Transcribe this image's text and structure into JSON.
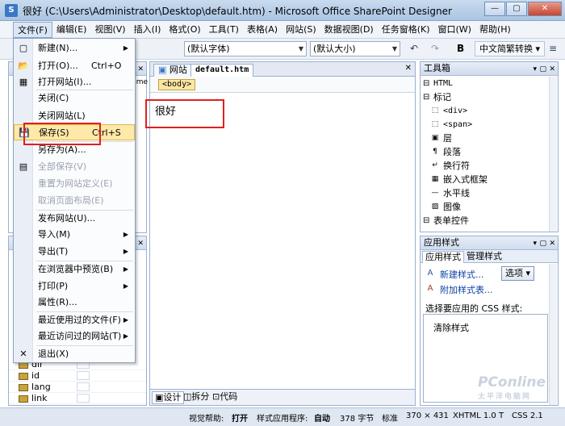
{
  "window": {
    "title": "很好 (C:\\Users\\Administrator\\Desktop\\default.htm) - Microsoft Office SharePoint Designer",
    "min": "—",
    "max": "▢",
    "close": "✕"
  },
  "menubar": [
    {
      "label": "文件(F)"
    },
    {
      "label": "编辑(E)"
    },
    {
      "label": "视图(V)"
    },
    {
      "label": "插入(I)"
    },
    {
      "label": "格式(O)"
    },
    {
      "label": "工具(T)"
    },
    {
      "label": "表格(A)"
    },
    {
      "label": "网站(S)"
    },
    {
      "label": "数据视图(D)"
    },
    {
      "label": "任务窗格(K)"
    },
    {
      "label": "窗口(W)"
    },
    {
      "label": "帮助(H)"
    }
  ],
  "toolbar": {
    "font": "(默认字体)",
    "size": "(默认大小)",
    "bold": "B",
    "convert": "中文简繁转换 ▾",
    "undo": "↶",
    "redo": "↷",
    "align": "≡"
  },
  "file_menu": {
    "items": [
      {
        "label": "新建(N)...",
        "shortcut": "",
        "sub": true,
        "icon": "new-icon",
        "glyph": "▢"
      },
      {
        "label": "打开(O)...",
        "shortcut": "Ctrl+O",
        "sub": false,
        "icon": "open-folder-icon",
        "glyph": "📂"
      },
      {
        "label": "打开网站(I)...",
        "shortcut": "",
        "sub": false,
        "icon": "open-site-icon",
        "glyph": "▦"
      },
      {
        "label": "关闭(C)",
        "shortcut": "",
        "sub": false,
        "icon": "",
        "glyph": ""
      },
      {
        "label": "关闭网站(L)",
        "shortcut": "",
        "sub": false,
        "icon": "",
        "glyph": ""
      },
      {
        "label": "保存(S)",
        "shortcut": "Ctrl+S",
        "sub": false,
        "icon": "save-icon",
        "glyph": "💾",
        "highlight": true
      },
      {
        "label": "另存为(A)...",
        "shortcut": "",
        "sub": false,
        "icon": "",
        "glyph": ""
      },
      {
        "label": "全部保存(V)",
        "shortcut": "",
        "sub": false,
        "icon": "save-all-icon",
        "glyph": "▤",
        "disabled": true
      },
      {
        "label": "重置为网站定义(E)",
        "shortcut": "",
        "sub": false,
        "icon": "",
        "glyph": "",
        "disabled": true
      },
      {
        "label": "取消页面布局(E)",
        "shortcut": "",
        "sub": false,
        "icon": "",
        "glyph": "",
        "disabled": true
      },
      {
        "label": "发布网站(U)...",
        "shortcut": "",
        "sub": false,
        "icon": "",
        "glyph": ""
      },
      {
        "label": "导入(M)",
        "shortcut": "",
        "sub": true,
        "icon": "",
        "glyph": ""
      },
      {
        "label": "导出(T)",
        "shortcut": "",
        "sub": true,
        "icon": "",
        "glyph": ""
      },
      {
        "label": "在浏览器中预览(B)",
        "shortcut": "",
        "sub": true,
        "icon": "",
        "glyph": ""
      },
      {
        "label": "打印(P)",
        "shortcut": "",
        "sub": true,
        "icon": "",
        "glyph": ""
      },
      {
        "label": "属性(R)...",
        "shortcut": "",
        "sub": false,
        "icon": "",
        "glyph": ""
      },
      {
        "label": "最近使用过的文件(F)",
        "shortcut": "",
        "sub": true,
        "icon": "",
        "glyph": ""
      },
      {
        "label": "最近访问过的网站(T)",
        "shortcut": "",
        "sub": true,
        "icon": "",
        "glyph": ""
      },
      {
        "label": "退出(X)",
        "shortcut": "",
        "sub": false,
        "icon": "exit-icon",
        "glyph": "✕"
      }
    ]
  },
  "left_panel_bottom": {
    "rows": [
      "dir",
      "id",
      "lang",
      "link"
    ],
    "fragment": "ume"
  },
  "editor": {
    "tab_site": "网站",
    "tab_file": "default.htm",
    "tag": "<body>",
    "content": "很好",
    "views": {
      "design": "设计",
      "split": "拆分",
      "code": "代码"
    }
  },
  "toolbox": {
    "title": "工具箱",
    "tree": [
      {
        "label": "HTML",
        "level": 0,
        "kind": "group",
        "mono": true
      },
      {
        "label": "标记",
        "level": 0,
        "kind": "group"
      },
      {
        "label": "<div>",
        "level": 1,
        "mono": true,
        "icon": "div-icon",
        "glyph": "⬚"
      },
      {
        "label": "<span>",
        "level": 1,
        "mono": true,
        "icon": "span-icon",
        "glyph": "⬚"
      },
      {
        "label": "层",
        "level": 1,
        "icon": "layer-icon",
        "glyph": "▣"
      },
      {
        "label": "段落",
        "level": 1,
        "icon": "paragraph-icon",
        "glyph": "¶"
      },
      {
        "label": "换行符",
        "level": 1,
        "icon": "line-break-icon",
        "glyph": "↵"
      },
      {
        "label": "嵌入式框架",
        "level": 1,
        "icon": "iframe-icon",
        "glyph": "▦"
      },
      {
        "label": "水平线",
        "level": 1,
        "icon": "hr-icon",
        "glyph": "—"
      },
      {
        "label": "图像",
        "level": 1,
        "icon": "image-icon",
        "glyph": "▨"
      },
      {
        "label": "表单控件",
        "level": 0,
        "kind": "group"
      }
    ]
  },
  "apply_styles": {
    "title": "应用样式",
    "tab_apply": "应用样式",
    "tab_manage": "管理样式",
    "new_style": "新建样式...",
    "attach_style": "附加样式表...",
    "options": "选项 ▾",
    "select_label": "选择要应用的 CSS 样式:",
    "clear_styles": "清除样式"
  },
  "statusbar": {
    "visual_help_label": "视觉帮助:",
    "visual_help_value": "打开",
    "style_app_label": "样式应用程序:",
    "style_app_value": "自动",
    "size": "378 字节",
    "mode": "标准",
    "dims": "370 × 431",
    "doctype": "XHTML 1.0 T",
    "css": "CSS 2.1"
  },
  "watermark": {
    "main": "PConline",
    "sub": "太平洋电脑网"
  },
  "colors": {
    "highlight": "#ffe9a8",
    "annotation": "#e02020",
    "link": "#0b3fa8"
  }
}
